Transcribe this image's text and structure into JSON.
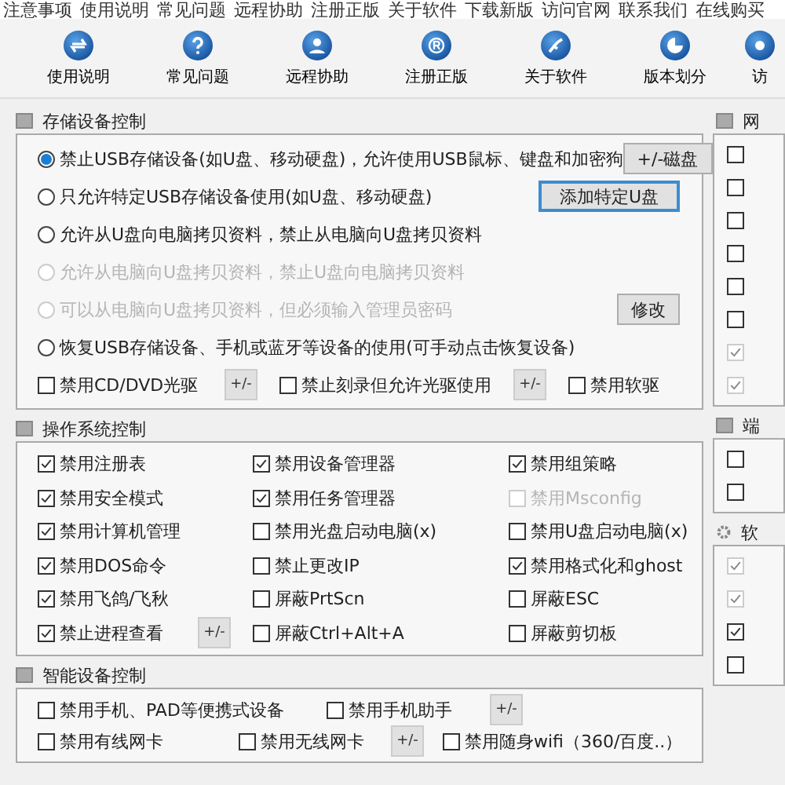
{
  "menu": [
    "注意事项",
    "使用说明",
    "常见问题",
    "远程协助",
    "注册正版",
    "关于软件",
    "下载新版",
    "访问官网",
    "联系我们",
    "在线购买"
  ],
  "toolbar": [
    {
      "label": "使用说明"
    },
    {
      "label": "常见问题"
    },
    {
      "label": "远程协助"
    },
    {
      "label": "注册正版"
    },
    {
      "label": "关于软件"
    },
    {
      "label": "版本划分"
    },
    {
      "label": "访"
    }
  ],
  "storage": {
    "title": "存储设备控制",
    "options": [
      {
        "label": "禁止USB存储设备(如U盘、移动硬盘)，允许使用USB鼠标、键盘和加密狗",
        "selected": true,
        "disabled": false,
        "button": "+/-磁盘"
      },
      {
        "label": "只允许特定USB存储设备使用(如U盘、移动硬盘)",
        "selected": false,
        "disabled": false,
        "button": "添加特定U盘"
      },
      {
        "label": "允许从U盘向电脑拷贝资料，禁止从电脑向U盘拷贝资料",
        "selected": false,
        "disabled": false
      },
      {
        "label": "允许从电脑向U盘拷贝资料，禁止U盘向电脑拷贝资料",
        "selected": false,
        "disabled": true
      },
      {
        "label": "可以从电脑向U盘拷贝资料，但必须输入管理员密码",
        "selected": false,
        "disabled": true,
        "button": "修改"
      },
      {
        "label": "恢复USB存储设备、手机或蓝牙等设备的使用(可手动点击恢复设备)",
        "selected": false,
        "disabled": false
      }
    ],
    "checks": [
      {
        "label": "禁用CD/DVD光驱",
        "checked": false,
        "button": "+/-"
      },
      {
        "label": "禁止刻录但允许光驱使用",
        "checked": false,
        "button": "+/-"
      },
      {
        "label": "禁用软驱",
        "checked": false
      }
    ]
  },
  "os": {
    "title": "操作系统控制",
    "items": [
      {
        "label": "禁用注册表",
        "checked": true,
        "disabled": false
      },
      {
        "label": "禁用设备管理器",
        "checked": true,
        "disabled": false
      },
      {
        "label": "禁用组策略",
        "checked": true,
        "disabled": false
      },
      {
        "label": "禁用安全模式",
        "checked": true,
        "disabled": false
      },
      {
        "label": "禁用任务管理器",
        "checked": true,
        "disabled": false
      },
      {
        "label": "禁用Msconfig",
        "checked": false,
        "disabled": true
      },
      {
        "label": "禁用计算机管理",
        "checked": true,
        "disabled": false
      },
      {
        "label": "禁用光盘启动电脑(x)",
        "checked": false,
        "disabled": false
      },
      {
        "label": "禁用U盘启动电脑(x)",
        "checked": false,
        "disabled": false
      },
      {
        "label": "禁用DOS命令",
        "checked": true,
        "disabled": false
      },
      {
        "label": "禁止更改IP",
        "checked": false,
        "disabled": false
      },
      {
        "label": "禁用格式化和ghost",
        "checked": true,
        "disabled": false
      },
      {
        "label": "禁用飞鸽/飞秋",
        "checked": true,
        "disabled": false
      },
      {
        "label": "屏蔽PrtScn",
        "checked": false,
        "disabled": false
      },
      {
        "label": "屏蔽ESC",
        "checked": false,
        "disabled": false
      },
      {
        "label": "禁止进程查看",
        "checked": true,
        "disabled": false,
        "button": "+/-"
      },
      {
        "label": "屏蔽Ctrl+Alt+A",
        "checked": false,
        "disabled": false
      },
      {
        "label": "屏蔽剪切板",
        "checked": false,
        "disabled": false
      }
    ]
  },
  "smart": {
    "title": "智能设备控制",
    "rows": [
      [
        {
          "label": "禁用手机、PAD等便携式设备",
          "checked": false
        },
        {
          "label": "禁用手机助手",
          "checked": false,
          "button": "+/-"
        }
      ],
      [
        {
          "label": "禁用有线网卡",
          "checked": false
        },
        {
          "label": "禁用无线网卡",
          "checked": false,
          "button": "+/-"
        },
        {
          "label": "禁用随身wifi（360/百度..）",
          "checked": false
        }
      ]
    ]
  },
  "side": [
    {
      "title": "网",
      "checks": [
        {
          "checked": false,
          "disabled": false
        },
        {
          "checked": false,
          "disabled": false
        },
        {
          "checked": false,
          "disabled": false
        },
        {
          "checked": false,
          "disabled": false
        },
        {
          "checked": false,
          "disabled": false
        },
        {
          "checked": false,
          "disabled": false
        },
        {
          "checked": true,
          "disabled": true
        },
        {
          "checked": true,
          "disabled": true
        }
      ]
    },
    {
      "title": "端",
      "checks": [
        {
          "checked": false,
          "disabled": false
        },
        {
          "checked": false,
          "disabled": false
        }
      ]
    },
    {
      "title": "软",
      "checks": [
        {
          "checked": true,
          "disabled": true
        },
        {
          "checked": true,
          "disabled": true
        },
        {
          "checked": true,
          "disabled": false
        },
        {
          "checked": false,
          "disabled": false
        }
      ]
    }
  ]
}
